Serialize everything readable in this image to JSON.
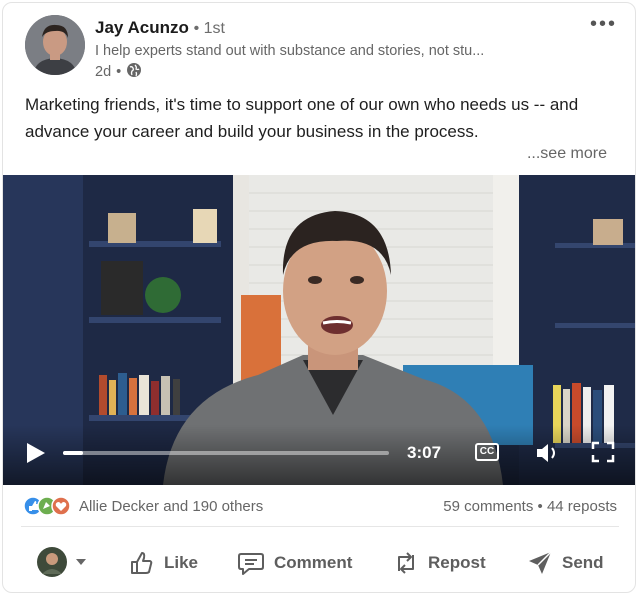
{
  "author": {
    "name": "Jay Acunzo",
    "degree": "1st",
    "headline": "I help experts stand out with substance and stories, not stu...",
    "age": "2d",
    "visibility_icon": "globe-icon"
  },
  "post": {
    "text": "Marketing friends, it's time to support one of our own who needs us -- and advance your career and build your business in the process.",
    "see_more": "...see more"
  },
  "video": {
    "time_remaining": "3:07",
    "progress": 0.06,
    "cc_label": "CC"
  },
  "social": {
    "reactions_text": "Allie Decker and 190 others",
    "comments": "59 comments",
    "reposts": "44 reposts",
    "separator": "•"
  },
  "actions": {
    "like": "Like",
    "comment": "Comment",
    "repost": "Repost",
    "send": "Send"
  },
  "colors": {
    "like_blue": "#378fe9",
    "celebrate_green": "#6dae4f",
    "love_red": "#df704d",
    "text_muted": "#666666"
  }
}
